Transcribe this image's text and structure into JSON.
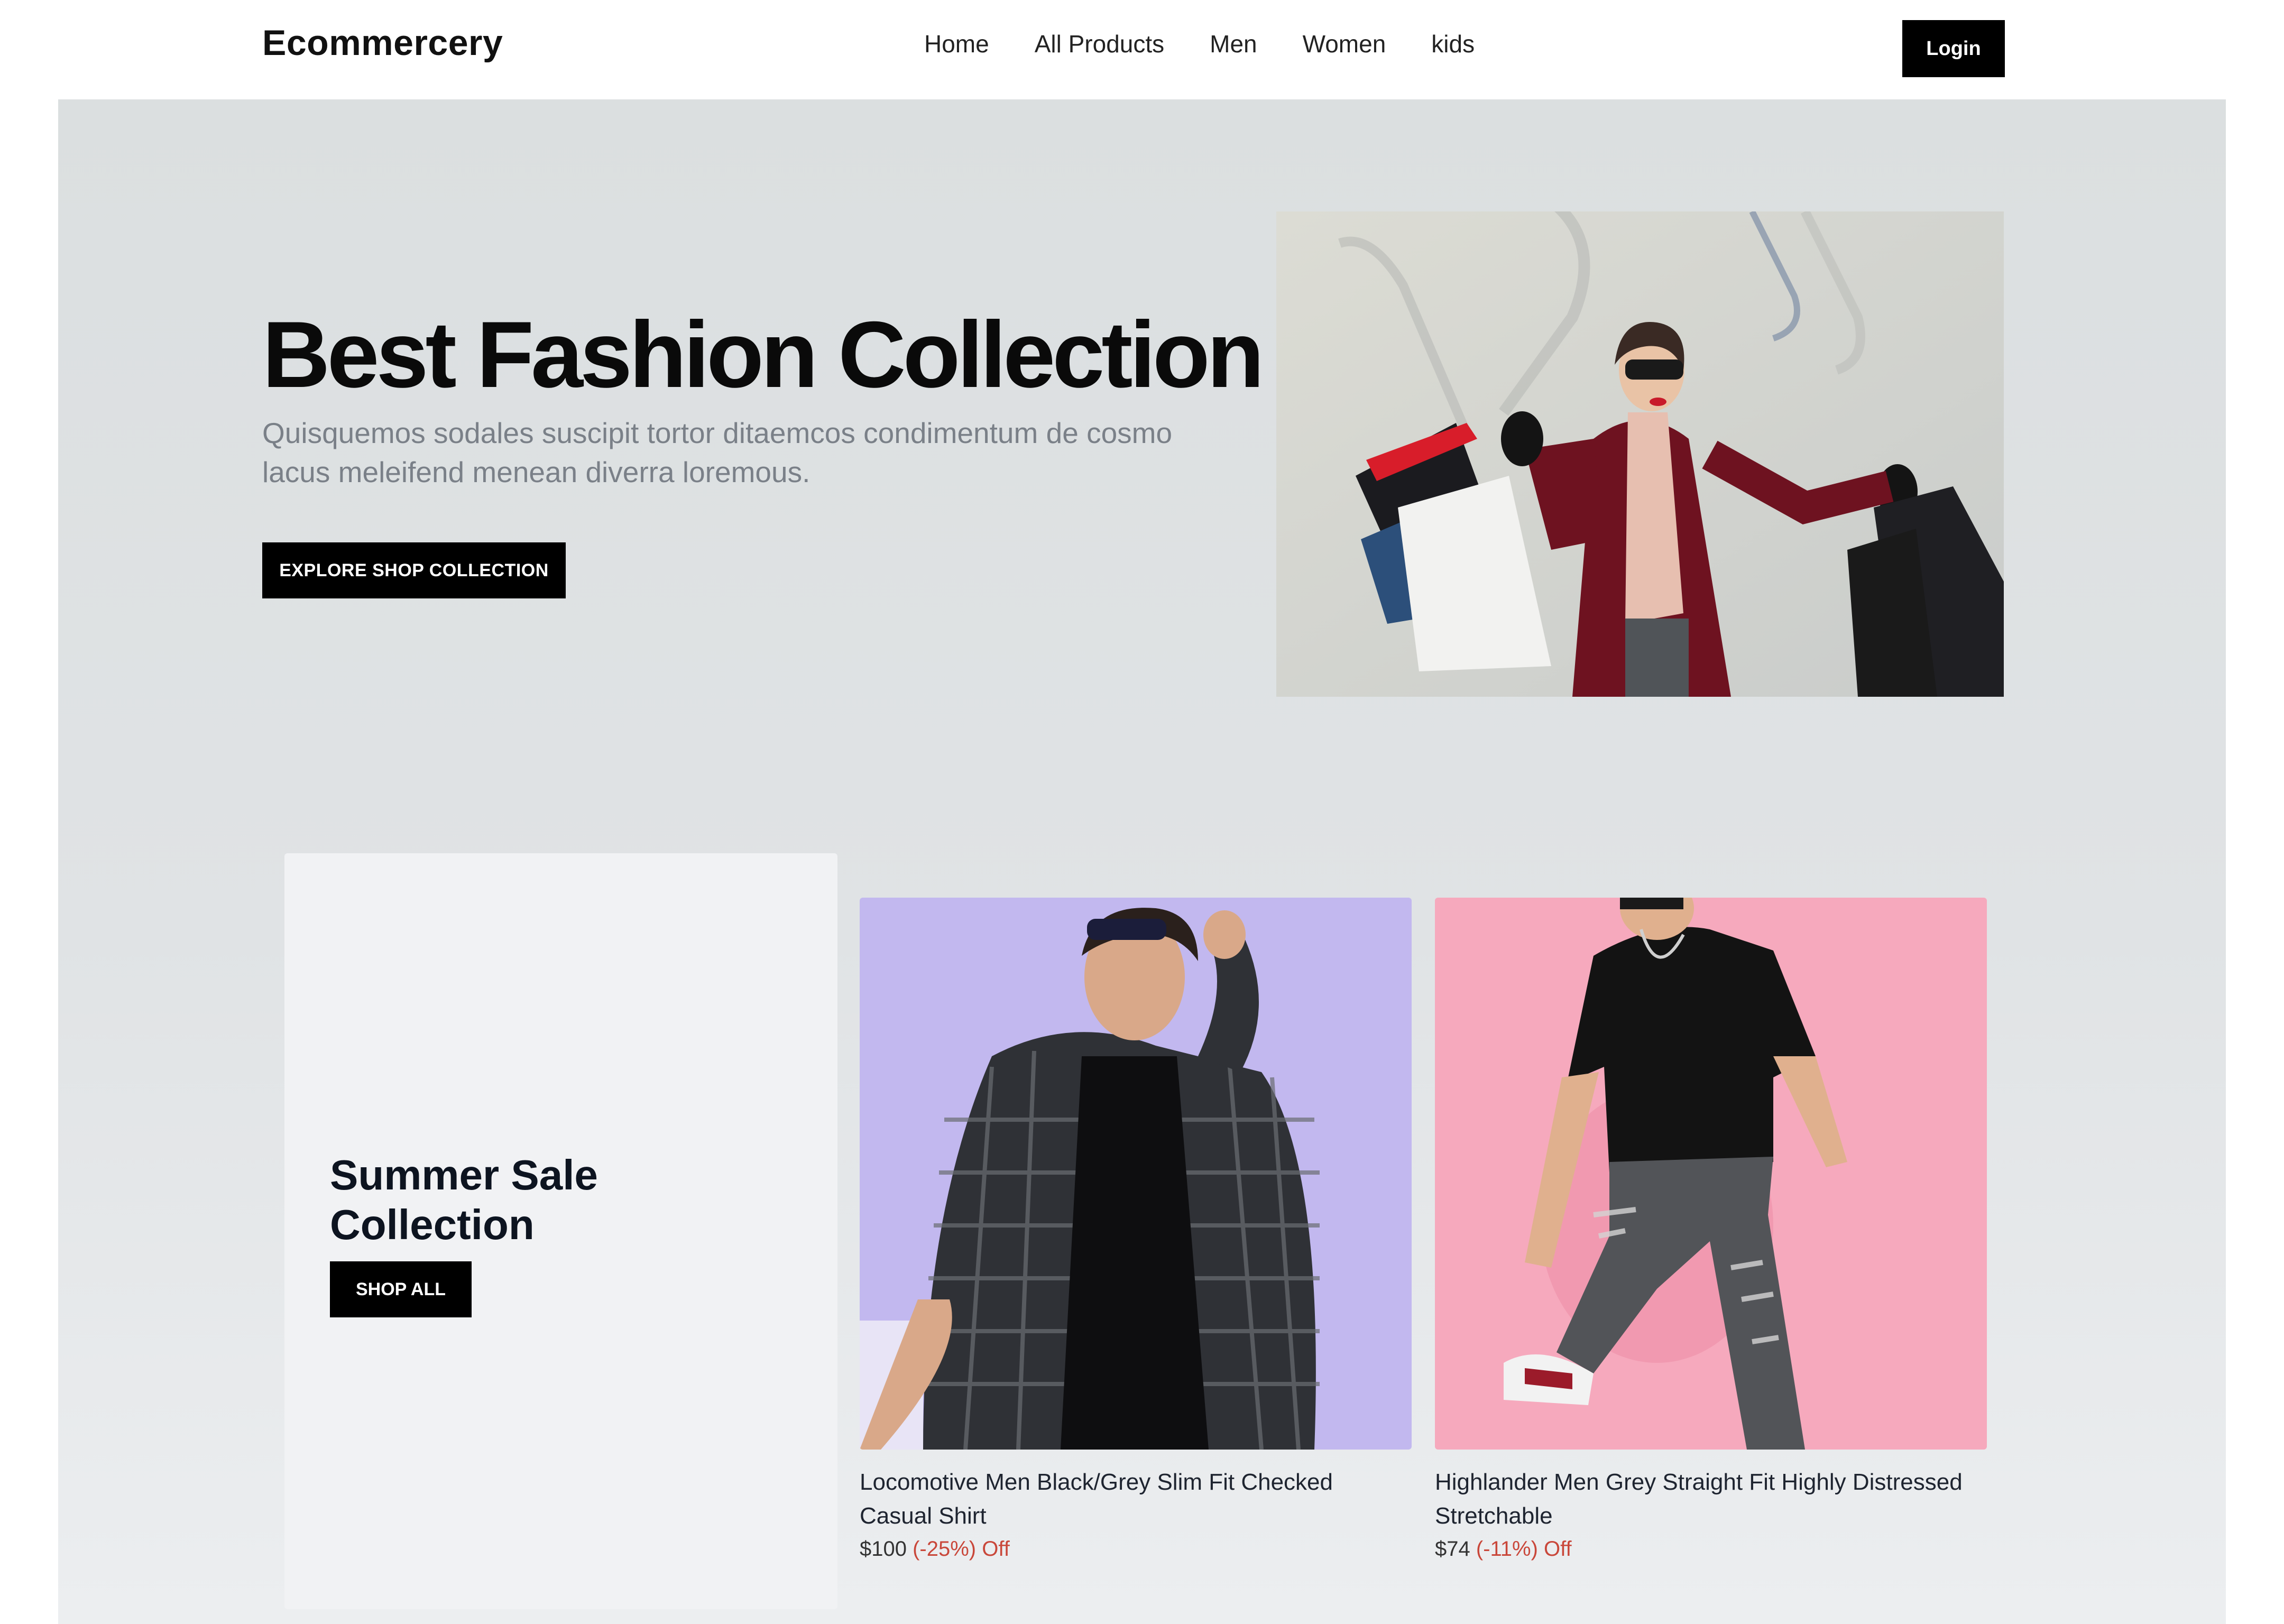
{
  "nav": {
    "brand": "Ecommercery",
    "links": [
      "Home",
      "All Products",
      "Men",
      "Women",
      "kids"
    ],
    "login_label": "Login"
  },
  "hero": {
    "title": "Best Fashion Collection",
    "description": "Quisquemos sodales suscipit tortor ditaemcos condimentum de cosmo lacus meleifend menean diverra loremous.",
    "cta_label": "EXPLORE SHOP COLLECTION",
    "image_subject": "woman-with-shopping-bags-photo"
  },
  "sale": {
    "title": "Summer Sale Collection",
    "cta_label": "SHOP ALL"
  },
  "products": [
    {
      "name": "Locomotive Men Black/Grey Slim Fit Checked Casual Shirt",
      "price": "$100",
      "discount": "(-25%) Off",
      "bg_color": "#c2b8ef"
    },
    {
      "name": "Highlander Men Grey Straight Fit Highly Distressed Stretchable",
      "price": "$74",
      "discount": "(-11%) Off",
      "bg_color": "#f6a9bd"
    }
  ],
  "colors": {
    "accent": "#000000",
    "discount": "#c9473a",
    "background": "#dfe2e4"
  }
}
